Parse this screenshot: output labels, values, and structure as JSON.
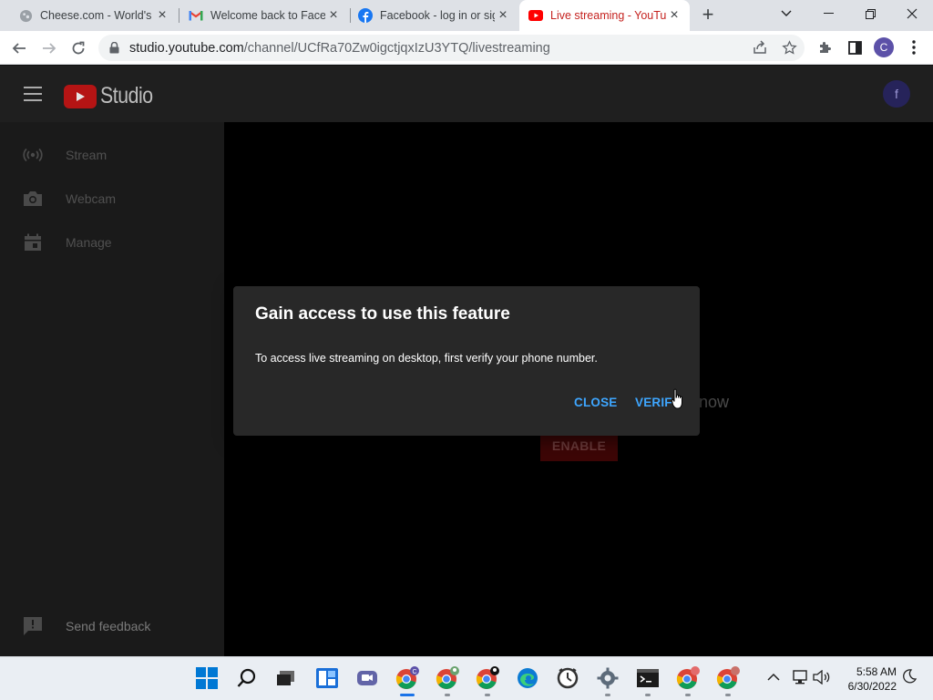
{
  "browser": {
    "tabs": [
      {
        "title": "Cheese.com - World's l",
        "favicon": "cheese-favicon"
      },
      {
        "title": "Welcome back to Faceb",
        "favicon": "gmail-favicon"
      },
      {
        "title": "Facebook - log in or sig",
        "favicon": "facebook-favicon"
      },
      {
        "title": "Live streaming - YouTu",
        "favicon": "youtube-favicon",
        "active": true
      }
    ],
    "url_host": "studio.youtube.com",
    "url_path": "/channel/UCfRa70Zw0igctjqxIzU3YTQ/livestreaming",
    "profile_initial": "C"
  },
  "studio": {
    "logo_text": "Studio",
    "avatar_initial": "f",
    "sidebar": {
      "items": [
        {
          "label": "Stream",
          "icon": "broadcast-icon"
        },
        {
          "label": "Webcam",
          "icon": "camera-icon"
        },
        {
          "label": "Manage",
          "icon": "calendar-icon"
        }
      ],
      "feedback_label": "Send feedback"
    },
    "background_text": "now",
    "enable_label": "ENABLE"
  },
  "dialog": {
    "title": "Gain access to use this feature",
    "body": "To access live streaming on desktop, first verify your phone number.",
    "close_label": "CLOSE",
    "verify_label": "VERIF"
  },
  "taskbar": {
    "time": "5:58 AM",
    "date": "6/30/2022"
  },
  "colors": {
    "accent_blue": "#3ea6ff",
    "youtube_red": "#cc0000",
    "dialog_bg": "#282828"
  }
}
